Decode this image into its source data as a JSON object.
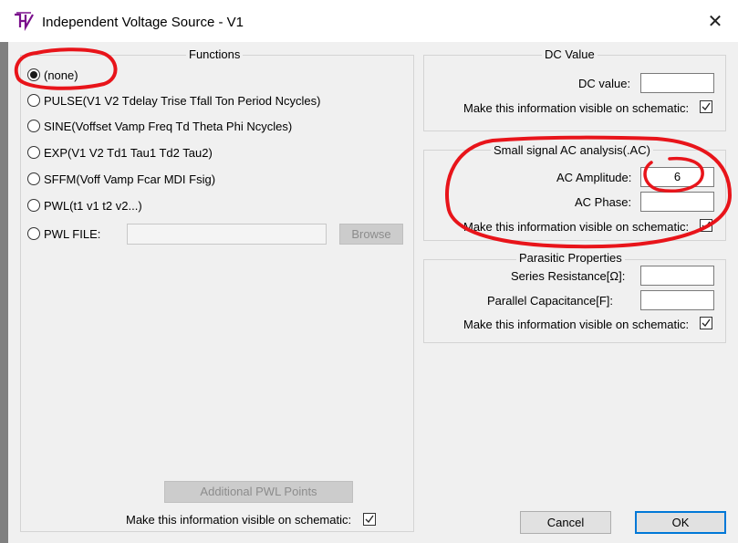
{
  "window": {
    "title": "Independent Voltage Source - V1",
    "close_icon": "close-icon",
    "app_icon": "ltspice-icon"
  },
  "functions": {
    "title": "Functions",
    "options": [
      {
        "label": "(none)",
        "checked": true
      },
      {
        "label": "PULSE(V1 V2 Tdelay Trise Tfall Ton Period Ncycles)",
        "checked": false
      },
      {
        "label": "SINE(Voffset Vamp Freq Td Theta Phi Ncycles)",
        "checked": false
      },
      {
        "label": "EXP(V1 V2 Td1 Tau1 Td2 Tau2)",
        "checked": false
      },
      {
        "label": "SFFM(Voff Vamp Fcar MDI Fsig)",
        "checked": false
      },
      {
        "label": "PWL(t1 v1 t2 v2...)",
        "checked": false
      },
      {
        "label": "PWL FILE:",
        "checked": false
      }
    ],
    "pwl_file_value": "",
    "browse_label": "Browse",
    "additional_pwl_label": "Additional PWL Points",
    "visible_label": "Make this information visible on schematic:",
    "visible_checked": true
  },
  "dc": {
    "title": "DC Value",
    "dc_value_label": "DC value:",
    "dc_value": "",
    "visible_label": "Make this information visible on schematic:",
    "visible_checked": true
  },
  "ac": {
    "title": "Small signal AC analysis(.AC)",
    "amplitude_label": "AC Amplitude:",
    "amplitude_value": "6",
    "phase_label": "AC Phase:",
    "phase_value": "",
    "visible_label": "Make this information visible on schematic:",
    "visible_checked": true
  },
  "parasitic": {
    "title": "Parasitic Properties",
    "series_label": "Series Resistance[Ω]:",
    "series_value": "",
    "parallel_label": "Parallel Capacitance[F]:",
    "parallel_value": "",
    "visible_label": "Make this information visible on schematic:",
    "visible_checked": true
  },
  "buttons": {
    "cancel": "Cancel",
    "ok": "OK"
  },
  "annotation_color": "#e8141a"
}
